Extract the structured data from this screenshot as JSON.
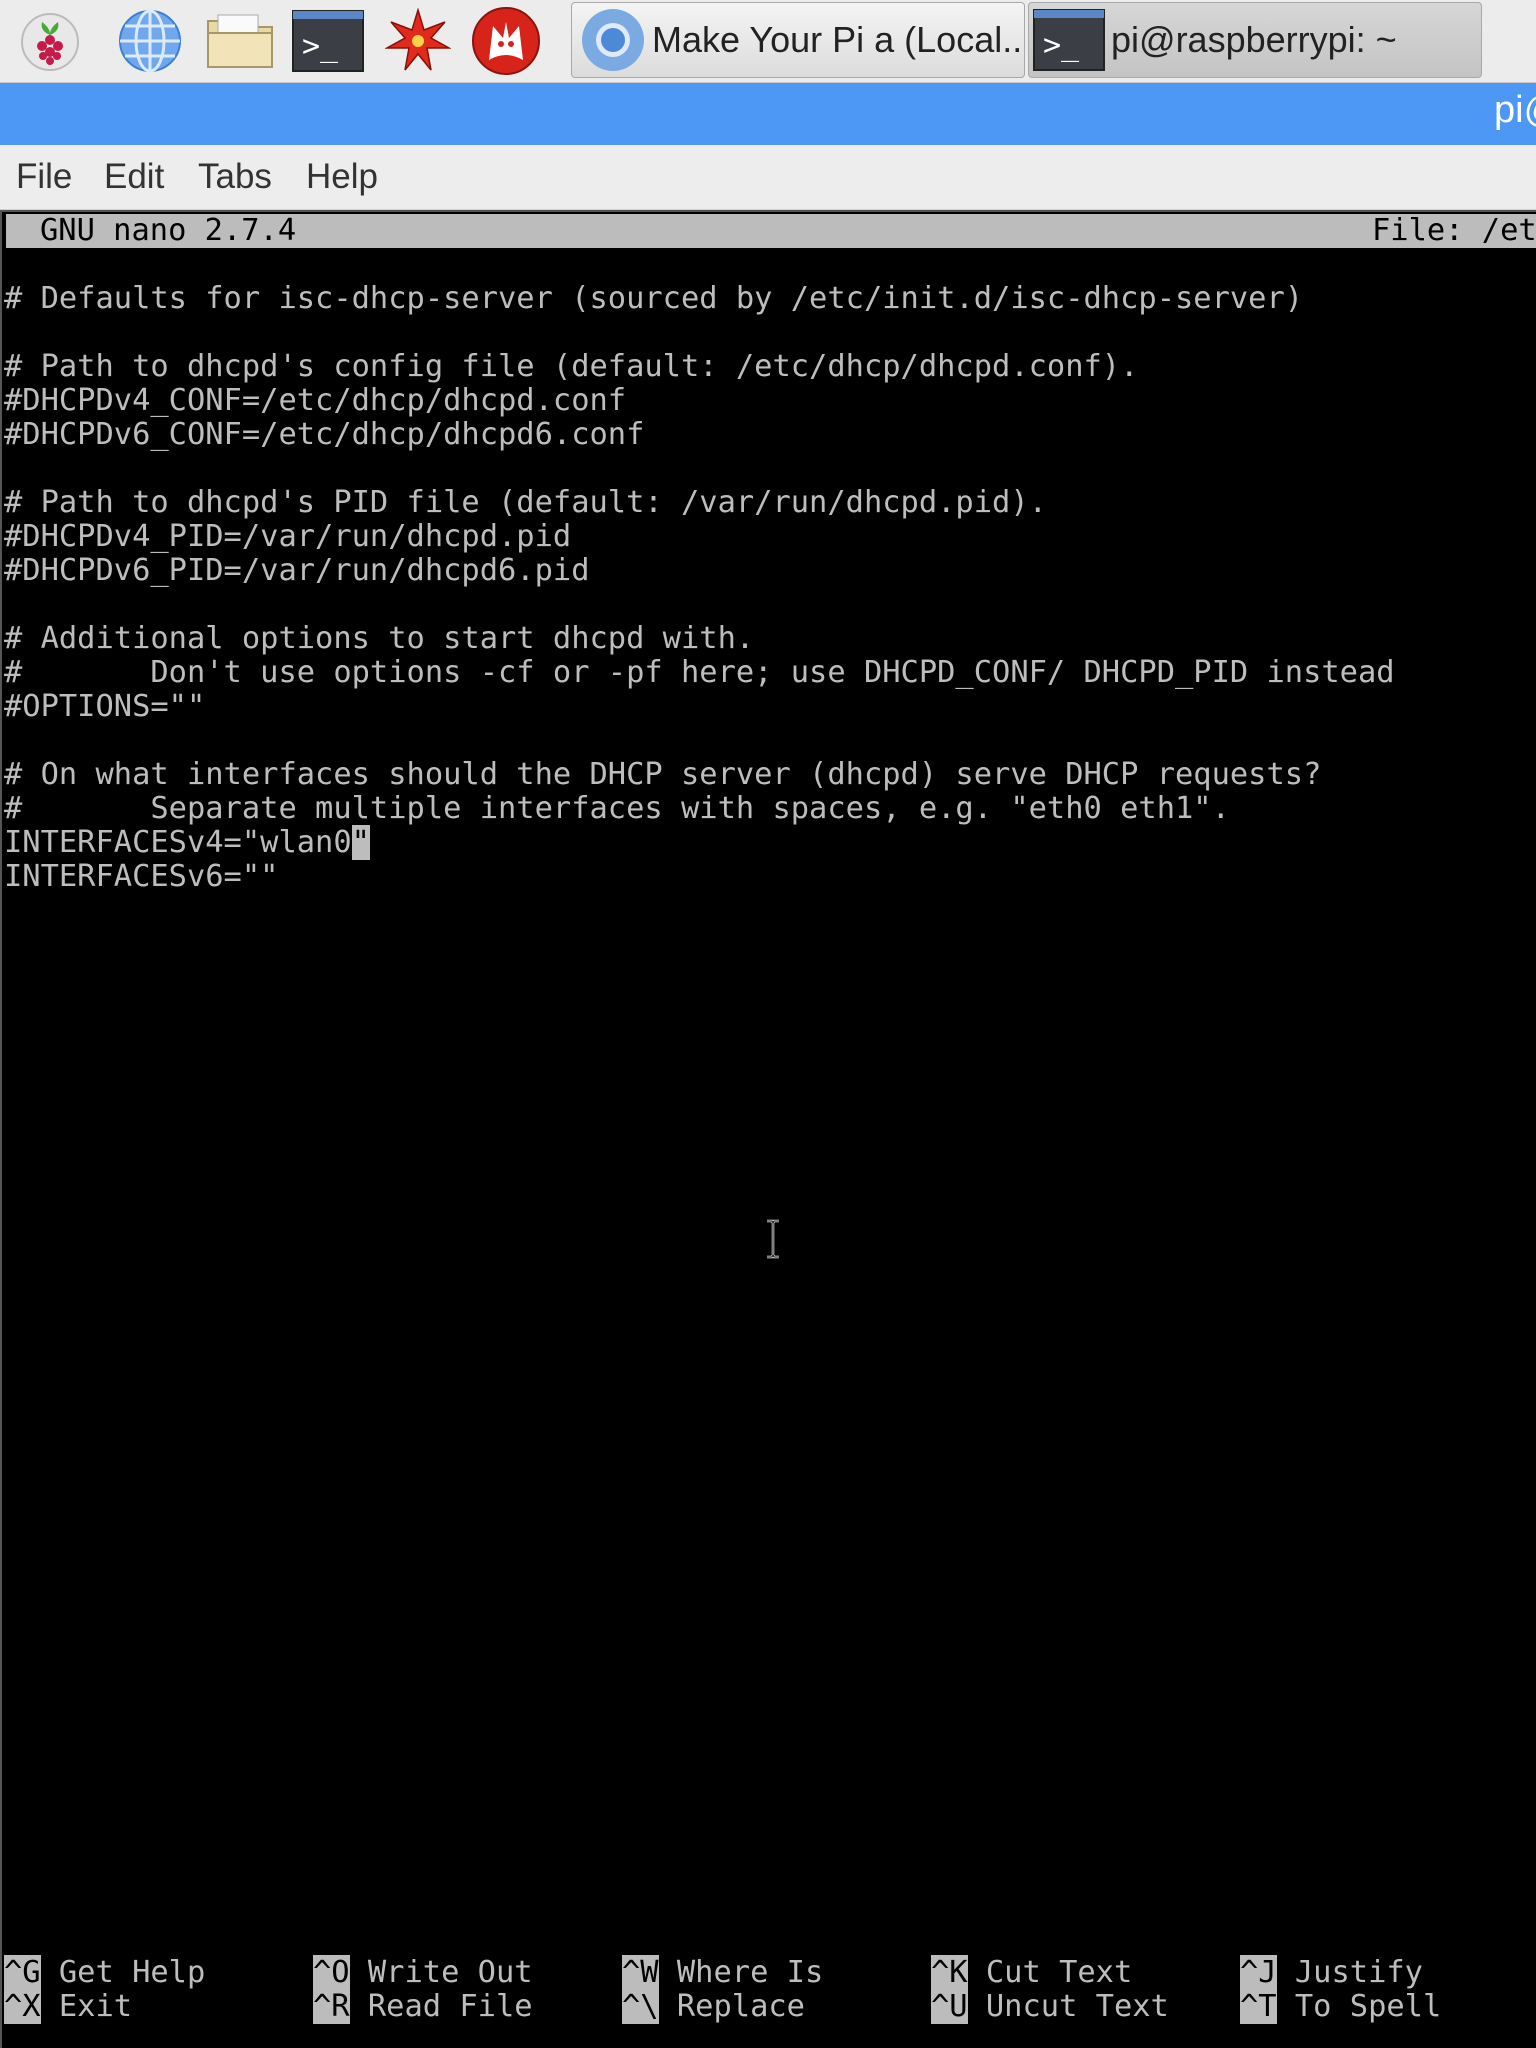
{
  "taskbar": {
    "launchers": [
      {
        "icon": "raspberry-menu-icon"
      },
      {
        "icon": "web-browser-icon"
      },
      {
        "icon": "file-manager-icon"
      },
      {
        "icon": "terminal-icon"
      },
      {
        "icon": "mathematica-icon"
      },
      {
        "icon": "wolfram-icon"
      }
    ],
    "tasks": [
      {
        "label": "Make Your Pi a (Local...",
        "icon": "chromium-icon"
      },
      {
        "label": "pi@raspberrypi: ~",
        "icon": "terminal-icon"
      }
    ]
  },
  "window": {
    "title": "pi@",
    "title_color": "#4d98f5"
  },
  "menubar": {
    "items": [
      "File",
      "Edit",
      "Tabs",
      "Help"
    ]
  },
  "nano": {
    "header_left": "GNU nano 2.7.4",
    "header_right": "File: /etc",
    "lines": [
      "# Defaults for isc-dhcp-server (sourced by /etc/init.d/isc-dhcp-server)",
      "",
      "# Path to dhcpd's config file (default: /etc/dhcp/dhcpd.conf).",
      "#DHCPDv4_CONF=/etc/dhcp/dhcpd.conf",
      "#DHCPDv6_CONF=/etc/dhcp/dhcpd6.conf",
      "",
      "# Path to dhcpd's PID file (default: /var/run/dhcpd.pid).",
      "#DHCPDv4_PID=/var/run/dhcpd.pid",
      "#DHCPDv6_PID=/var/run/dhcpd6.pid",
      "",
      "# Additional options to start dhcpd with.",
      "#       Don't use options -cf or -pf here; use DHCPD_CONF/ DHCPD_PID instead",
      "#OPTIONS=\"\"",
      "",
      "# On what interfaces should the DHCP server (dhcpd) serve DHCP requests?",
      "#       Separate multiple interfaces with spaces, e.g. \"eth0 eth1\".",
      "",
      "INTERFACESv6=\"\""
    ],
    "cursor_line": {
      "before": "INTERFACESv4=\"wlan0",
      "cursor_char": "\""
    },
    "shortcuts": [
      [
        {
          "key": "^G",
          "label": "Get Help"
        },
        {
          "key": "^X",
          "label": "Exit"
        }
      ],
      [
        {
          "key": "^O",
          "label": "Write Out"
        },
        {
          "key": "^R",
          "label": "Read File"
        }
      ],
      [
        {
          "key": "^W",
          "label": "Where Is"
        },
        {
          "key": "^\\",
          "label": "Replace"
        }
      ],
      [
        {
          "key": "^K",
          "label": "Cut Text"
        },
        {
          "key": "^U",
          "label": "Uncut Text"
        }
      ],
      [
        {
          "key": "^J",
          "label": "Justify"
        },
        {
          "key": "^T",
          "label": "To Spell"
        }
      ]
    ]
  },
  "colors": {
    "terminal_bg": "#000000",
    "terminal_fg": "#bdbdbd",
    "header_bg": "#bcbcbc",
    "taskbar_bg": "#ececec"
  }
}
